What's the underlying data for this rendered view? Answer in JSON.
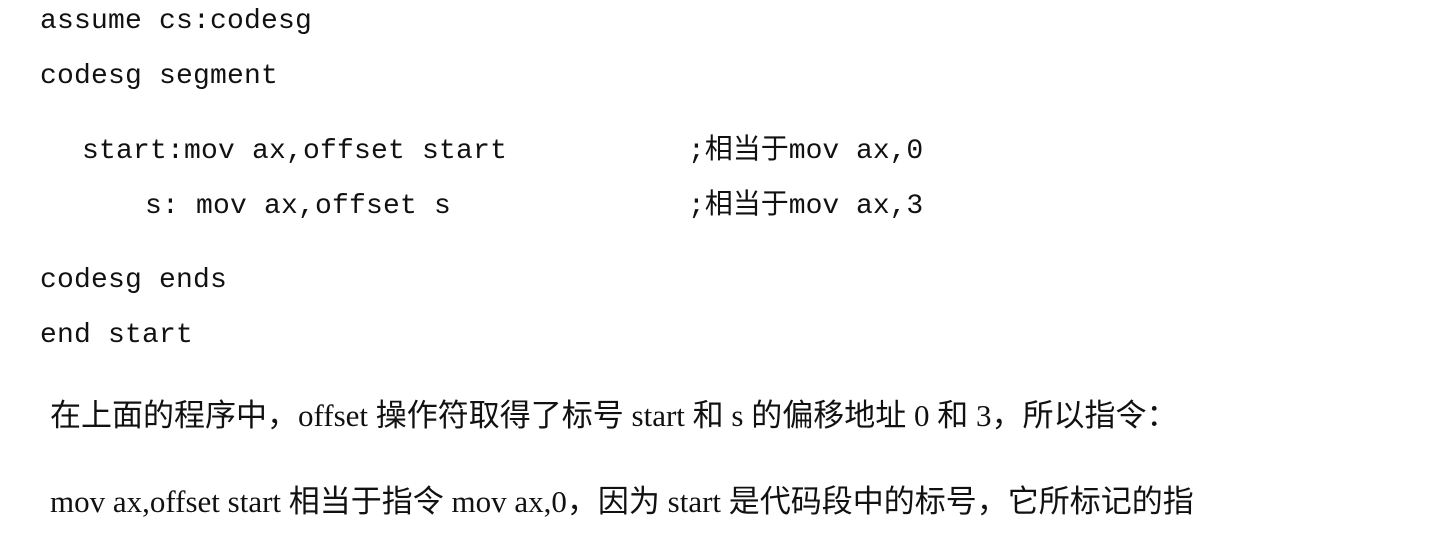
{
  "code": {
    "line1": "assume cs:codesg",
    "line2": "codesg segment",
    "line3": "start:mov ax,offset start",
    "line3_comment": ";相当于mov ax,0",
    "line4": "s: mov ax,offset s",
    "line4_comment": ";相当于mov ax,3",
    "line5": "codesg ends",
    "line6": "end start"
  },
  "prose": {
    "line1": "在上面的程序中，offset 操作符取得了标号 start 和 s 的偏移地址 0 和 3，所以指令：",
    "line2": "mov ax,offset start 相当于指令 mov ax,0，因为 start 是代码段中的标号，它所标记的指"
  }
}
